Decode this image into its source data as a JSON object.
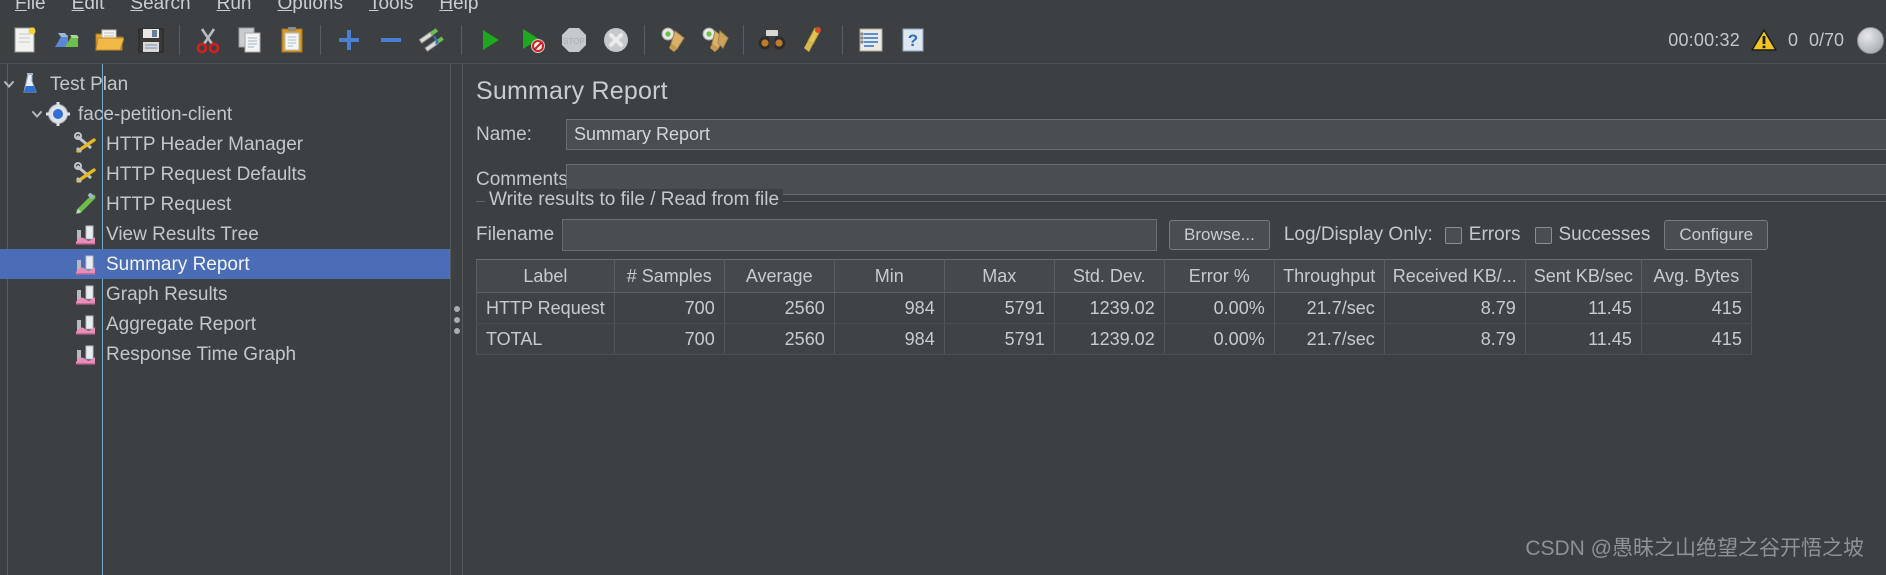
{
  "menu": {
    "items": [
      {
        "label": "File",
        "mnemonic": "F"
      },
      {
        "label": "Edit",
        "mnemonic": "E"
      },
      {
        "label": "Search",
        "mnemonic": "S"
      },
      {
        "label": "Run",
        "mnemonic": "R"
      },
      {
        "label": "Options",
        "mnemonic": "O"
      },
      {
        "label": "Tools",
        "mnemonic": "T"
      },
      {
        "label": "Help",
        "mnemonic": "H"
      }
    ]
  },
  "toolbar": {
    "buttons": [
      {
        "name": "new-icon",
        "title": "New"
      },
      {
        "name": "templates-icon",
        "title": "Templates"
      },
      {
        "name": "open-icon",
        "title": "Open"
      },
      {
        "name": "save-icon",
        "title": "Save Test Plan"
      },
      {
        "name": "cut-icon",
        "title": "Cut"
      },
      {
        "name": "copy-icon",
        "title": "Copy"
      },
      {
        "name": "paste-icon",
        "title": "Paste"
      },
      {
        "name": "expand-all-icon",
        "title": "Expand All"
      },
      {
        "name": "collapse-all-icon",
        "title": "Collapse All"
      },
      {
        "name": "toggle-icon",
        "title": "Toggle"
      },
      {
        "name": "start-icon",
        "title": "Start"
      },
      {
        "name": "start-no-pauses-icon",
        "title": "Start no pauses"
      },
      {
        "name": "stop-icon",
        "title": "Stop"
      },
      {
        "name": "shutdown-icon",
        "title": "Shutdown"
      },
      {
        "name": "clear-icon",
        "title": "Clear"
      },
      {
        "name": "clear-all-icon",
        "title": "Clear All"
      },
      {
        "name": "search-binoculars-icon",
        "title": "Search"
      },
      {
        "name": "reset-search-icon",
        "title": "Reset Search"
      },
      {
        "name": "function-helper-icon",
        "title": "Function Helper Dialog"
      },
      {
        "name": "help-icon",
        "title": "Help"
      }
    ]
  },
  "status": {
    "timer": "00:00:32",
    "warning_count": "0",
    "threads": "0/70"
  },
  "tree": {
    "items": [
      {
        "label": "Test Plan",
        "icon": "test-plan-icon",
        "depth": 0,
        "expanded": true,
        "selected": false
      },
      {
        "label": "face-petition-client",
        "icon": "thread-group-icon",
        "depth": 1,
        "expanded": true,
        "selected": false
      },
      {
        "label": "HTTP Header Manager",
        "icon": "header-manager-icon",
        "depth": 2,
        "expanded": null,
        "selected": false
      },
      {
        "label": "HTTP Request Defaults",
        "icon": "config-defaults-icon",
        "depth": 2,
        "expanded": null,
        "selected": false
      },
      {
        "label": "HTTP Request",
        "icon": "http-request-icon",
        "depth": 2,
        "expanded": null,
        "selected": false
      },
      {
        "label": "View Results Tree",
        "icon": "listener-icon",
        "depth": 2,
        "expanded": null,
        "selected": false
      },
      {
        "label": "Summary Report",
        "icon": "listener-icon",
        "depth": 2,
        "expanded": null,
        "selected": true
      },
      {
        "label": "Graph Results",
        "icon": "listener-icon",
        "depth": 2,
        "expanded": null,
        "selected": false
      },
      {
        "label": "Aggregate Report",
        "icon": "listener-icon",
        "depth": 2,
        "expanded": null,
        "selected": false
      },
      {
        "label": "Response Time Graph",
        "icon": "listener-icon",
        "depth": 2,
        "expanded": null,
        "selected": false
      }
    ]
  },
  "panel": {
    "title": "Summary Report",
    "name_label": "Name:",
    "name_value": "Summary Report",
    "comments_label": "Comments:",
    "comments_value": "",
    "group_legend": "Write results to file / Read from file",
    "filename_label": "Filename",
    "filename_value": "",
    "browse_label": "Browse...",
    "logdisplay_label": "Log/Display Only:",
    "errors_label": "Errors",
    "errors_checked": false,
    "successes_label": "Successes",
    "successes_checked": false,
    "configure_label": "Configure"
  },
  "table": {
    "columns": [
      "Label",
      "# Samples",
      "Average",
      "Min",
      "Max",
      "Std. Dev.",
      "Error %",
      "Throughput",
      "Received KB/...",
      "Sent KB/sec",
      "Avg. Bytes"
    ],
    "rows": [
      [
        "HTTP Request",
        "700",
        "2560",
        "984",
        "5791",
        "1239.02",
        "0.00%",
        "21.7/sec",
        "8.79",
        "11.45",
        "415"
      ],
      [
        "TOTAL",
        "700",
        "2560",
        "984",
        "5791",
        "1239.02",
        "0.00%",
        "21.7/sec",
        "8.79",
        "11.45",
        "415"
      ]
    ]
  },
  "watermark": "CSDN @愚昧之山绝望之谷开悟之坡",
  "colors": {
    "background": "#3c4043",
    "selection": "#4a6db5",
    "text": "#c3c7cb",
    "guide_line": "#7fb6e8"
  }
}
